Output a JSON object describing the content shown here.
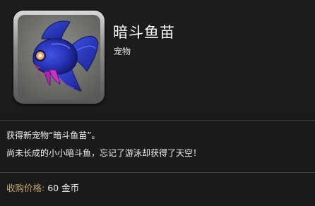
{
  "item": {
    "name": "暗斗鱼苗",
    "category": "宠物",
    "icon": "fighting-fish-icon"
  },
  "description": {
    "line1": "获得新宠物“暗斗鱼苗”。",
    "line2": "尚未长成的小小暗斗鱼，忘记了游泳却获得了天空！"
  },
  "price": {
    "label": "收购价格:",
    "value": "60 金币"
  },
  "colors": {
    "background": "#1c1c1c",
    "title": "#ffffff",
    "price_label": "#c3a773",
    "fish_body": "#2b3ed0",
    "fish_fin_accent": "#c236c8",
    "eye": "#f0c070"
  }
}
